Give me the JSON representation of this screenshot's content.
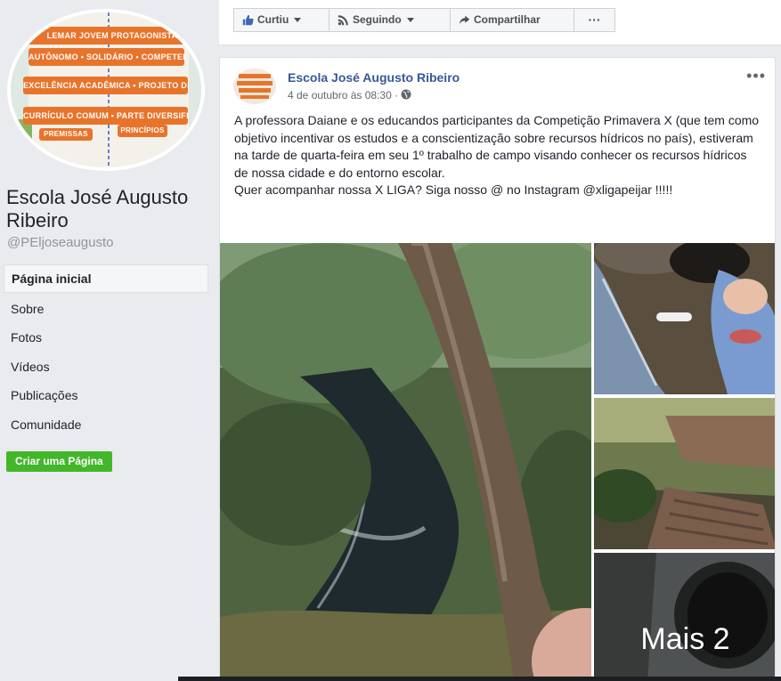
{
  "sidebar": {
    "page_name": "Escola José Augusto Ribeiro",
    "handle": "@PEljoseaugusto",
    "profile_banners": [
      "LEMAR JOVEM PROTAGONISTA",
      "AUTÔNOMO • SOLIDÁRIO • COMPETENTE",
      "EXCELÊNCIA ACADÊMICA • PROJETO DE VIDA",
      "CURRÍCULO COMUM • PARTE DIVERSIFICADA",
      "PREMISSAS",
      "PRINCÍPIOS"
    ],
    "nav_items": [
      {
        "label": "Página inicial"
      },
      {
        "label": "Sobre"
      },
      {
        "label": "Fotos"
      },
      {
        "label": "Vídeos"
      },
      {
        "label": "Publicações"
      },
      {
        "label": "Comunidade"
      }
    ],
    "create_page_label": "Criar uma Página"
  },
  "topbar": {
    "like_label": "Curtiu",
    "follow_label": "Seguindo",
    "share_label": "Compartilhar",
    "more_label": "···"
  },
  "post": {
    "author": "Escola José Augusto Ribeiro",
    "timestamp": "4 de outubro às 08:30 ·",
    "more_label": "•••",
    "text_lines": [
      "A professora Daiane e os educandos participantes da Competição Primavera X (que tem como objetivo incentivar os estudos e a conscientização sobre recursos hídricos no país), estiveram na tarde de quarta-feira em seu 1º trabalho de campo visando conhecer os recursos hídricos de nossa cidade e do entorno escolar.",
      "Quer acompanhar nossa X LIGA? Siga nosso @ no Instagram @xligapeijar !!!!!"
    ],
    "more_photos_label": "Mais 2"
  },
  "colors": {
    "facebook_blue": "#365899",
    "green_button": "#42b72a",
    "page_bg": "#e9ebee",
    "banner_orange": "#e8742b"
  },
  "icons": [
    "thumbs-up-icon",
    "rss-icon",
    "share-arrow-icon",
    "globe-icon",
    "more-dots-icon"
  ]
}
